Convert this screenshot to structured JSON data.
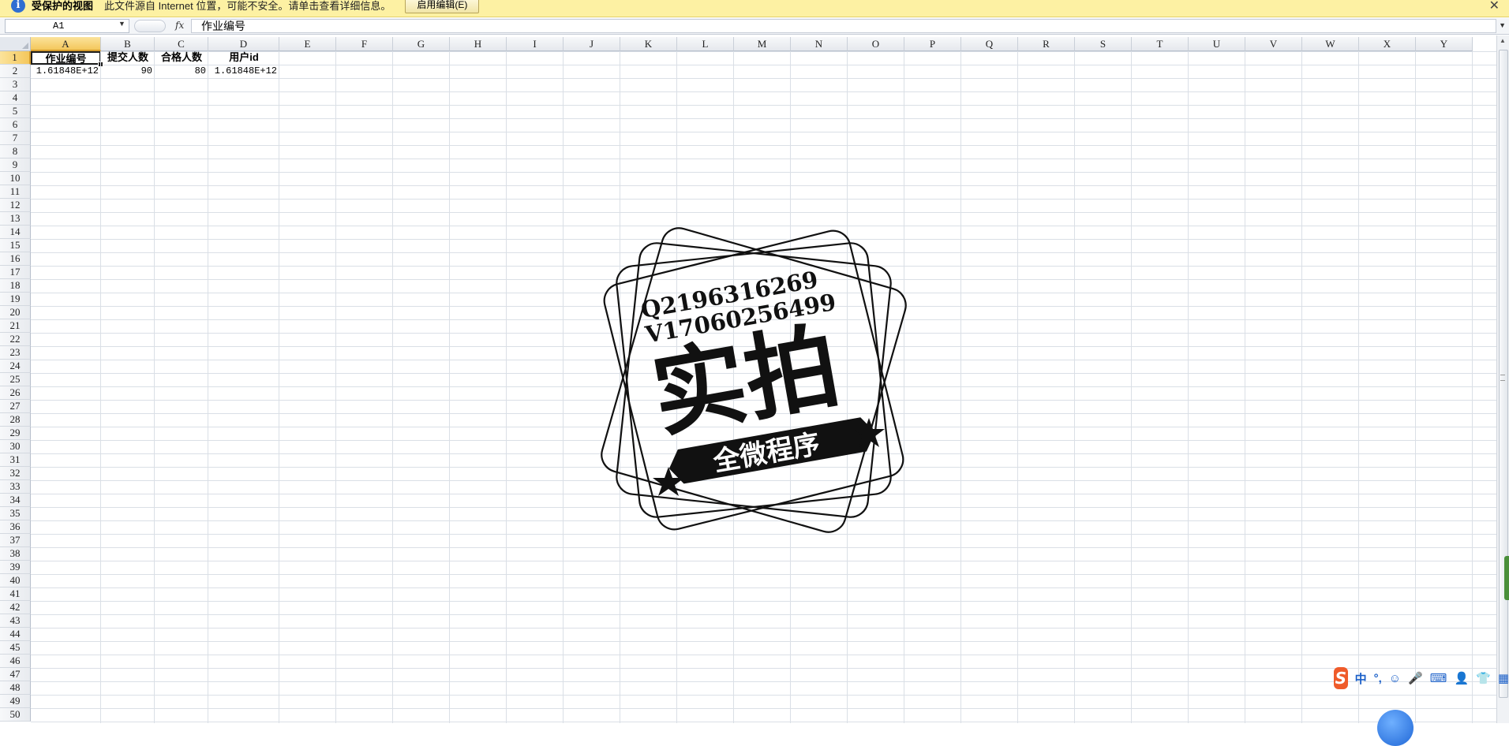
{
  "protected_view": {
    "title": "受保护的视图",
    "message": "此文件源自 Internet 位置，可能不安全。请单击查看详细信息。",
    "enable_button": "启用编辑(E)",
    "close_glyph": "✕"
  },
  "formula_bar": {
    "name_box": "A1",
    "fx": "fx",
    "content": "作业编号"
  },
  "columns": [
    "A",
    "B",
    "C",
    "D",
    "E",
    "F",
    "G",
    "H",
    "I",
    "J",
    "K",
    "L",
    "M",
    "N",
    "O",
    "P",
    "Q",
    "R",
    "S",
    "T",
    "U",
    "V",
    "W",
    "X",
    "Y"
  ],
  "selected_column": "A",
  "rows": [
    "1",
    "2",
    "3",
    "4",
    "5",
    "6",
    "7",
    "8",
    "9",
    "10",
    "11",
    "12",
    "13",
    "14",
    "15",
    "16",
    "17",
    "18",
    "19",
    "20",
    "21",
    "22",
    "23",
    "24",
    "25",
    "26",
    "27",
    "28",
    "29",
    "30",
    "31",
    "32",
    "33",
    "34",
    "35",
    "36",
    "37",
    "38",
    "39",
    "40",
    "41",
    "42",
    "43",
    "44",
    "45",
    "46",
    "47",
    "48",
    "49",
    "50"
  ],
  "selected_row": "1",
  "sheet": {
    "headers": [
      "作业编号",
      "提交人数",
      "合格人数",
      "用户id"
    ],
    "row2": [
      "1.61848E+12",
      "90",
      "80",
      "1.61848E+12"
    ]
  },
  "watermark": {
    "line1": "Q2196316269",
    "line2": "V17060256499",
    "big_text": "实拍",
    "banner": "全微程序"
  },
  "ime": {
    "logo": "S",
    "lang": "中",
    "items": [
      "°,",
      "☺",
      "🎤",
      "⌨",
      "👤",
      "👕",
      "▦"
    ]
  },
  "colors": {
    "protected_bar": "#fdf1a3",
    "header_selected": "#f4c75c",
    "gridline": "#dadfe6"
  }
}
